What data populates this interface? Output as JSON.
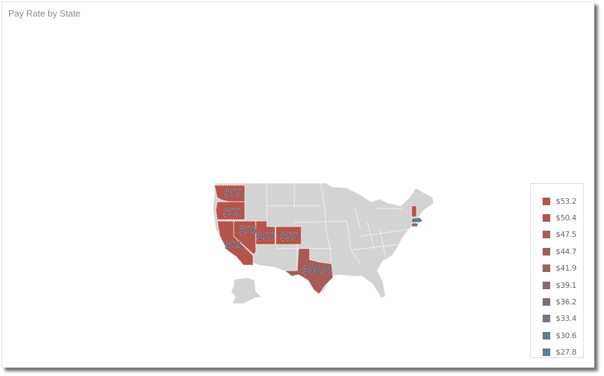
{
  "visual": {
    "title": "Pay Rate by State",
    "base_color": "#d3d3d3",
    "legend": [
      {
        "label": "$53.2",
        "color": "#b5544a"
      },
      {
        "label": "$50.4",
        "color": "#ad5752"
      },
      {
        "label": "$47.5",
        "color": "#a65b58"
      },
      {
        "label": "$44.7",
        "color": "#9e5f5e"
      },
      {
        "label": "$41.9",
        "color": "#946466"
      },
      {
        "label": "$39.1",
        "color": "#8a6a70"
      },
      {
        "label": "$36.2",
        "color": "#7f6f7a"
      },
      {
        "label": "$33.4",
        "color": "#747583"
      },
      {
        "label": "$30.6",
        "color": "#687c8b"
      },
      {
        "label": "$27.8",
        "color": "#5a8194"
      }
    ],
    "states": [
      {
        "name": "Washington",
        "value_label": "$55",
        "color": "#b5544a"
      },
      {
        "name": "Oregon",
        "value_label": "$55",
        "color": "#b5544a"
      },
      {
        "name": "California",
        "value_label": "$55",
        "color": "#b5544a"
      },
      {
        "name": "Nevada",
        "value_label": "$56",
        "color": "#b5544a"
      },
      {
        "name": "Utah",
        "value_label": "$55",
        "color": "#b5544a"
      },
      {
        "name": "Colorado",
        "value_label": "$55",
        "color": "#b5544a"
      },
      {
        "name": "Texas",
        "value_label": "$48.8",
        "color": "#a65b58"
      },
      {
        "name": "Vermont",
        "value_label": "",
        "color": "#b5544a"
      },
      {
        "name": "Massachusetts",
        "value_label": "",
        "color": "#5a8194"
      },
      {
        "name": "Connecticut",
        "value_label": "",
        "color": "#946466"
      }
    ]
  }
}
